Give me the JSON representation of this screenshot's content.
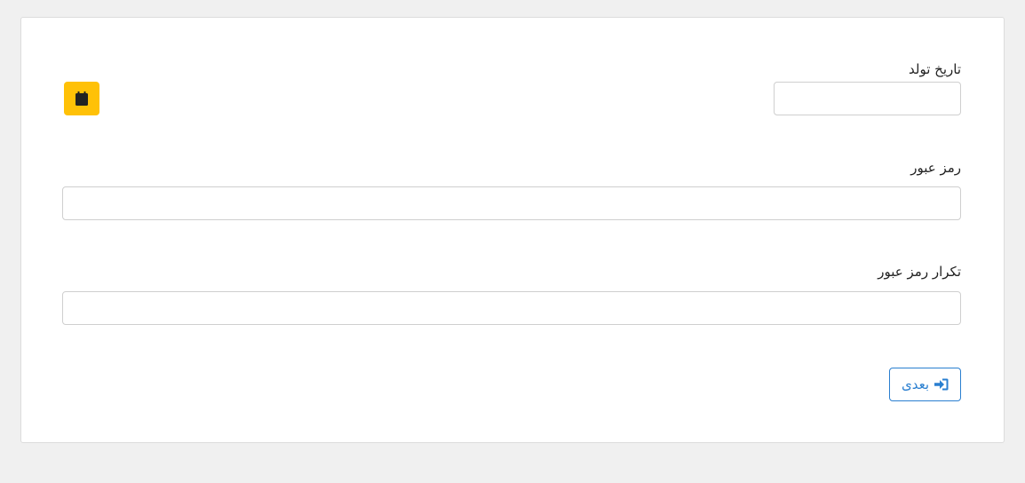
{
  "form": {
    "birth_date": {
      "label": "تاریخ تولد",
      "value": "",
      "calendar_icon": "calendar-icon"
    },
    "password": {
      "label": "رمز عبور",
      "value": ""
    },
    "password_repeat": {
      "label": "تکرار رمز عبور",
      "value": ""
    },
    "next_button": {
      "label": "بعدی",
      "icon": "sign-in-icon"
    }
  },
  "colors": {
    "accent": "#ffc107",
    "primary": "#2a7fd0",
    "background": "#f0f0f0",
    "card": "#ffffff"
  }
}
